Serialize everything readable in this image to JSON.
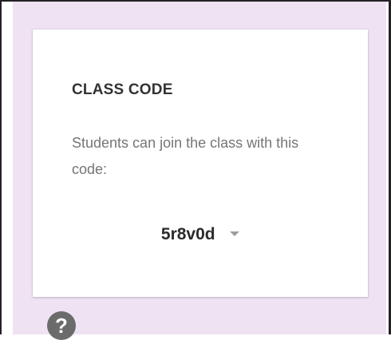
{
  "class_code_card": {
    "title": "CLASS CODE",
    "description": "Students can join the class with this code:",
    "code": "5r8v0d",
    "dropdown_icon": "caret-down-icon"
  },
  "help": {
    "icon": "help-icon",
    "glyph": "?"
  },
  "colors": {
    "panel_background": "#efe2f3",
    "card_background": "#ffffff",
    "title_text": "#333333",
    "description_text": "#757575",
    "code_text": "#2b2b2b",
    "icon_gray": "#9e9e9e",
    "help_icon_background": "#6b6b6b"
  }
}
